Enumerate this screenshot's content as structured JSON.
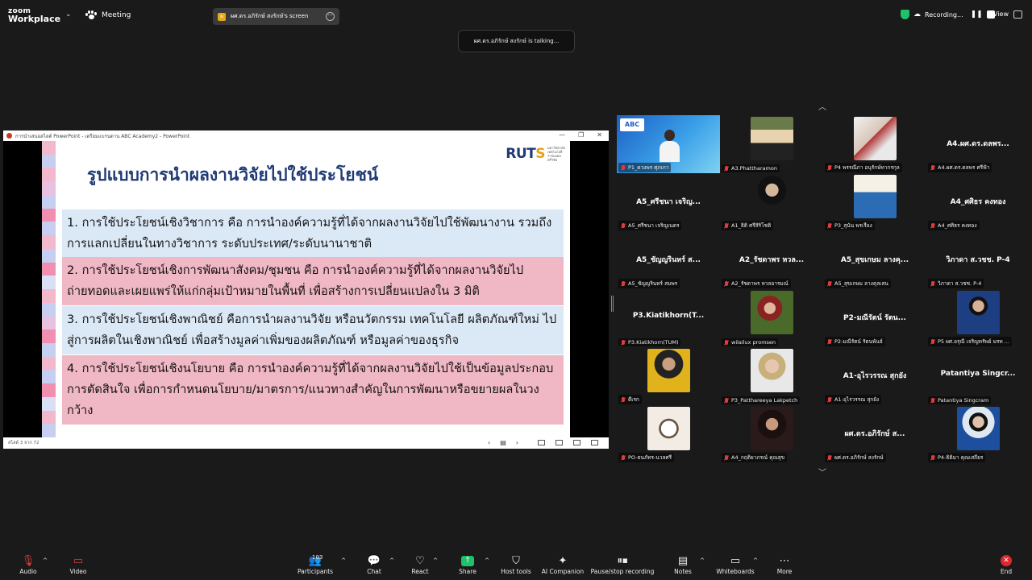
{
  "app": {
    "brand_top": "zoom",
    "brand_bottom": "Workplace",
    "meeting_label": "Meeting",
    "share_pill": "ผศ.ดร.อภิรักษ์ สงรักษ์'s screen",
    "share_pill_avatar": "ผ",
    "recording_label": "Recording...",
    "view_label": "View",
    "talking": "ผศ.ดร.อภิรักษ์ สงรักษ์ is talking..."
  },
  "ppt": {
    "window_title": "การนำเสนอสไลด์ PowerPoint  -  เตรียมแบรนดาน ABC Academy2 - PowerPoint",
    "status": "สไลด์ 3 จาก 72",
    "ruts_main": "RUT",
    "ruts_accent": "S",
    "ruts_tag": "มหาวิทยาลัยเทคโนโลยีราชมงคลศรีวิชัย",
    "slide_title": "รูปแบบการนำผลงานวิจัยไปใช้ประโยชน์",
    "items": [
      "1. การใช้ประโยชน์เชิงวิชาการ คือ การนำองค์ความรู้ที่ได้จากผลงานวิจัยไปใช้พัฒนางาน รวมถึงการแลกเปลี่ยนในทางวิชาการ ระดับประเทศ/ระดับนานาชาติ",
      "2. การใช้ประโยชน์เชิงการพัฒนาสังคม/ชุมชน คือ การนำองค์ความรู้ที่ได้จากผลงานวิจัยไปถ่ายทอดและเผยแพร่ให้แก่กลุ่มเป้าหมายในพื้นที่ เพื่อสร้างการเปลี่ยนแปลงใน 3 มิติ",
      "3. การใช้ประโยชน์เชิงพาณิชย์ คือการนำผลงานวิจัย หรือนวัตกรรม เทคโนโลยี ผลิตภัณฑ์ใหม่ ไปสู่การผลิตในเชิงพาณิชย์ เพื่อสร้างมูลค่าเพิ่มของผลิตภัณฑ์ หรือมูลค่าของธุรกิจ",
      "4. การใช้ประโยชน์เชิงนโยบาย คือ การนำองค์ความรู้ที่ได้จากผลงานวิจัยไปใช้เป็นข้อมูลประกอบการตัดสินใจ เพื่อการกำหนดนโยบาย/มาตรการ/แนวทางสำคัญในการพัฒนาหรือขยายผลในวงกว้าง"
    ]
  },
  "gallery": {
    "active_logo": "ABC",
    "tiles": [
      {
        "name": "",
        "label": "P1_ดวงพร ศุภเกา",
        "photo": "active"
      },
      {
        "name": "",
        "label": "A3.Phattharamon",
        "photo": "avatar-cartoon"
      },
      {
        "name": "",
        "label": "P4 พรรณีภา อนุรักษ์ทากรกุล",
        "photo": "woman-desk"
      },
      {
        "name": "A4.ผศ.ดร.ดลพร...",
        "label": "A4.ผศ.ดร.ดลพร ศรีฟ้า",
        "photo": ""
      },
      {
        "name": "A5_ศรีชนา เจริญ...",
        "label": "A5_ศรีชนา เจริญเนตร",
        "photo": ""
      },
      {
        "name": "",
        "label": "A1_ธิติ ศรีสิริโชติ",
        "photo": "man-dark"
      },
      {
        "name": "",
        "label": "P3_สุนัน พรเรือง",
        "photo": "man-learning"
      },
      {
        "name": "A4_ศศิธร คงทอง",
        "label": "A4_ศศิธร คงทอง",
        "photo": ""
      },
      {
        "name": "A5_ชัญญรินทร์ ส...",
        "label": "A5_ชัญญรินทร์ สมพร",
        "photo": ""
      },
      {
        "name": "A2_รัชดาพร หวล...",
        "label": "A2_รัชดาพร หวลอารมณ์",
        "photo": ""
      },
      {
        "name": "A5_สุขเกษม ลางคุ...",
        "label": "A5_สุขเกษม ลางคุลเสน",
        "photo": ""
      },
      {
        "name": "วิภาดา  ส.วชช. P-4",
        "label": "วิภาดา  ส.วชช. P-4",
        "photo": ""
      },
      {
        "name": "P3.Kiatikhorn(T...",
        "label": "P3.Kiatikhorn(TUM)",
        "photo": ""
      },
      {
        "name": "",
        "label": "wilailux promsen",
        "photo": "woman-flowers"
      },
      {
        "name": "P2-มณีรัตน์ รัตน...",
        "label": "P2-มณีรัตน์ รัตนพันธ์",
        "photo": ""
      },
      {
        "name": "",
        "label": "P5 ผศ.อรุณี เจริญทรัพย์ มรท ...",
        "photo": "woman-blue"
      },
      {
        "name": "",
        "label": "ดีเรก",
        "photo": "man-yellow"
      },
      {
        "name": "",
        "label": "P3_Patthareeya Lakpetch",
        "photo": "woman-blonde"
      },
      {
        "name": "A1-อุไรวรรณ สุกยัง",
        "label": "A1-อุไรวรรณ สุกยัง",
        "photo": ""
      },
      {
        "name": "Patantiya  Singcr...",
        "label": "Patantiya  Singcram",
        "photo": ""
      },
      {
        "name": "",
        "label": "PO-ธนภัทร-นวลศรี",
        "photo": "seal"
      },
      {
        "name": "",
        "label": "A4_กฤติยาภรณ์ คุณสุข",
        "photo": "woman-dark"
      },
      {
        "name": "ผศ.ดร.อภิรักษ์  ส...",
        "label": "ผศ.ดร.อภิรักษ์ สงรักษ์",
        "photo": ""
      },
      {
        "name": "",
        "label": "P4-ธิติมา คุณเสถียร",
        "photo": "woman-uniform"
      }
    ]
  },
  "toolbar": {
    "audio": "Audio",
    "video": "Video",
    "participants": "Participants",
    "participants_count": "103",
    "chat": "Chat",
    "react": "React",
    "share": "Share",
    "host_tools": "Host tools",
    "ai_companion": "AI Companion",
    "pause_recording": "Pause/stop recording",
    "notes": "Notes",
    "whiteboards": "Whiteboards",
    "more": "More",
    "end": "End"
  }
}
